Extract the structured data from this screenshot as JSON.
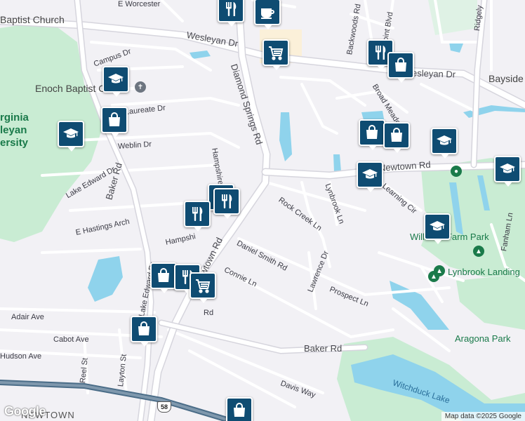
{
  "colors": {
    "pin": "#0f4c72",
    "road": "#ffffff",
    "road_outline": "#d6d5dd",
    "water": "#8fd3ec",
    "park": "#c9ecd3",
    "background": "#f2f1f5"
  },
  "streets": {
    "e_worcester": "E Worcester",
    "wesleyan_dr": "Wesleyan Dr",
    "wesleyan_dr_east": "Wesleyan Dr",
    "diamond_springs": "Diamond Springs Rd",
    "baker_rd": "Baker Rd",
    "baker_rd_south": "Baker Rd",
    "laureate_dr": "Laureate Dr",
    "weblin_dr": "Weblin Dr",
    "lake_edward": "Lake Edward Dr",
    "lake_edward_south": "Lake Edward Dr",
    "hampshire": "Hampshire",
    "hampshire_2": "Hampshi",
    "e_hastings": "E Hastings Arch",
    "newtown_rd": "Newtown Rd",
    "newtown_rd_east": "Newtown Rd",
    "connie_ln": "Connie Ln",
    "daniel_smith": "Daniel Smith Rd",
    "rock_creek": "Rock Creek Ln",
    "lynbrook_ln": "Lynbrook Ln",
    "lawrence_dr": "Lawrence Dr",
    "prospect_ln": "Prospect Ln",
    "learning_cir": "Learning Cir",
    "adair_ave": "Adair Ave",
    "cabot_ave": "Cabot Ave",
    "hudson_ave": "Hudson Ave",
    "reel_st": "Reel St",
    "layton_st": "Layton St",
    "davis_way": "Davis Way",
    "backwoods": "Backwoods Rd",
    "point_blvd": "Point Blvd",
    "broad_meadows": "Broad Meadow",
    "ridgely": "Ridgely",
    "fanham": "Fanham Ln",
    "campus_dr": "Campus Dr",
    "rd_fragment": "Rd"
  },
  "places": {
    "baptist_church": "Baptist Church",
    "enoch_baptist": "Enoch Baptist Ch",
    "university": [
      "rginia",
      "leyan",
      "ersity"
    ],
    "williams_farm_park": "Williams Farm Park",
    "lynbrook_landing": "Lynbrook Landing",
    "aragona_park": "Aragona Park",
    "witchduck_lake": "Witchduck Lake",
    "bayside": "Bayside",
    "newtown": "NEWTOWN",
    "route_58": "58"
  },
  "pins": [
    {
      "name": "restaurant-pin-top",
      "icon": "fork-knife-icon",
      "type": "restaurant"
    },
    {
      "name": "cafe-pin",
      "icon": "coffee-cup-icon",
      "type": "cafe"
    },
    {
      "name": "grocery-pin-wesleyan",
      "icon": "shopping-cart-icon",
      "type": "grocery"
    },
    {
      "name": "restaurant-pin-wesleyan-east",
      "icon": "fork-knife-icon",
      "type": "restaurant"
    },
    {
      "name": "shop-pin-wesleyan-east",
      "icon": "shopping-bag-icon",
      "type": "shop"
    },
    {
      "name": "school-pin-campus",
      "icon": "graduation-cap-icon",
      "type": "school"
    },
    {
      "name": "shop-pin-laureate",
      "icon": "shopping-bag-icon",
      "type": "shop"
    },
    {
      "name": "school-pin-west",
      "icon": "graduation-cap-icon",
      "type": "school"
    },
    {
      "name": "shop-pin-broad-1",
      "icon": "shopping-bag-icon",
      "type": "shop"
    },
    {
      "name": "shop-pin-broad-2",
      "icon": "shopping-bag-icon",
      "type": "shop"
    },
    {
      "name": "school-pin-east",
      "icon": "graduation-cap-icon",
      "type": "school"
    },
    {
      "name": "school-pin-newtown",
      "icon": "graduation-cap-icon",
      "type": "school"
    },
    {
      "name": "school-pin-far-east",
      "icon": "graduation-cap-icon",
      "type": "school"
    },
    {
      "name": "restaurant-pin-hampshire-1",
      "icon": "fork-knife-icon",
      "type": "restaurant"
    },
    {
      "name": "restaurant-pin-hampshire-2",
      "icon": "fork-knife-icon",
      "type": "restaurant"
    },
    {
      "name": "restaurant-pin-hampshire-3",
      "icon": "fork-knife-icon",
      "type": "restaurant"
    },
    {
      "name": "school-pin-williams",
      "icon": "graduation-cap-icon",
      "type": "school"
    },
    {
      "name": "shop-pin-newtown-1",
      "icon": "shopping-bag-icon",
      "type": "shop"
    },
    {
      "name": "restaurant-pin-newtown",
      "icon": "fork-knife-icon",
      "type": "restaurant"
    },
    {
      "name": "grocery-pin-newtown",
      "icon": "shopping-cart-icon",
      "type": "grocery"
    },
    {
      "name": "shop-pin-lake-edward",
      "icon": "shopping-bag-icon",
      "type": "shop"
    },
    {
      "name": "shop-pin-bottom",
      "icon": "shopping-bag-icon",
      "type": "shop"
    }
  ],
  "attribution": "Map data ©2025 Google",
  "logo": "Google"
}
